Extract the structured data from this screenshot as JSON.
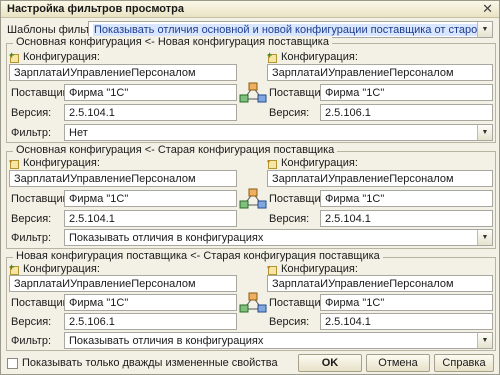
{
  "window": {
    "title": "Настройка фильтров просмотра",
    "close_glyph": "✕"
  },
  "templates": {
    "label": "Шаблоны фильтров:",
    "value": "Показывать отличия основной и новой конфигурации поставщика от старой конфигурации постав"
  },
  "groups": [
    {
      "title": "Основная конфигурация <- Новая конфигурация поставщика",
      "left": {
        "label": "Конфигурация:",
        "config": "ЗарплатаИУправлениеПерсоналом",
        "supplier_label": "Поставщик:",
        "supplier": "Фирма \"1С\"",
        "version_label": "Версия:",
        "version": "2.5.104.1"
      },
      "right": {
        "label": "Конфигурация:",
        "config": "ЗарплатаИУправлениеПерсоналом",
        "supplier_label": "Поставщик:",
        "supplier": "Фирма \"1С\"",
        "version_label": "Версия:",
        "version": "2.5.106.1"
      },
      "filter_label": "Фильтр:",
      "filter": "Нет"
    },
    {
      "title": "Основная конфигурация <- Старая конфигурация поставщика",
      "left": {
        "label": "Конфигурация:",
        "config": "ЗарплатаИУправлениеПерсоналом",
        "supplier_label": "Поставщик:",
        "supplier": "Фирма \"1С\"",
        "version_label": "Версия:",
        "version": "2.5.104.1"
      },
      "right": {
        "label": "Конфигурация:",
        "config": "ЗарплатаИУправлениеПерсоналом",
        "supplier_label": "Поставщик:",
        "supplier": "Фирма \"1С\"",
        "version_label": "Версия:",
        "version": "2.5.104.1"
      },
      "filter_label": "Фильтр:",
      "filter": "Показывать отличия в конфигурациях"
    },
    {
      "title": "Новая конфигурация поставщика <- Старая конфигурация поставщика",
      "left": {
        "label": "Конфигурация:",
        "config": "ЗарплатаИУправлениеПерсоналом",
        "supplier_label": "Поставщик:",
        "supplier": "Фирма \"1С\"",
        "version_label": "Версия:",
        "version": "2.5.106.1"
      },
      "right": {
        "label": "Конфигурация:",
        "config": "ЗарплатаИУправлениеПерсоналом",
        "supplier_label": "Поставщик:",
        "supplier": "Фирма \"1С\"",
        "version_label": "Версия:",
        "version": "2.5.104.1"
      },
      "filter_label": "Фильтр:",
      "filter": "Показывать отличия в конфигурациях"
    }
  ],
  "footer": {
    "checkbox_label": "Показывать только дважды измененные свойства",
    "ok": "OK",
    "cancel": "Отмена",
    "help": "Справка"
  }
}
